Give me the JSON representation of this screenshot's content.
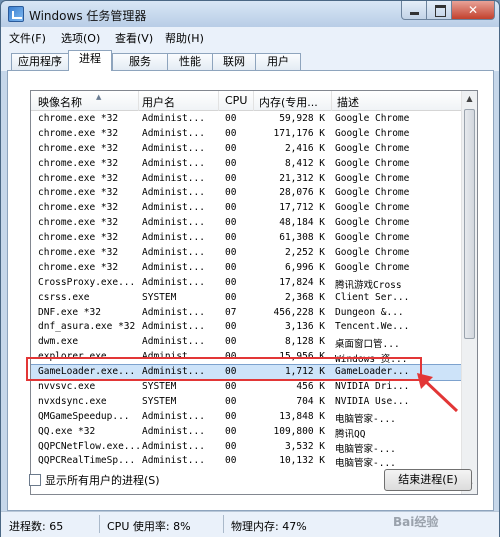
{
  "window": {
    "title": "Windows 任务管理器"
  },
  "menu": [
    {
      "label": "文件(F)"
    },
    {
      "label": "选项(O)"
    },
    {
      "label": "查看(V)"
    },
    {
      "label": "帮助(H)"
    }
  ],
  "tabs": [
    {
      "label": "应用程序"
    },
    {
      "label": "进程"
    },
    {
      "label": "服务"
    },
    {
      "label": "性能"
    },
    {
      "label": "联网"
    },
    {
      "label": "用户"
    }
  ],
  "columns": [
    {
      "label": "映像名称"
    },
    {
      "label": "用户名"
    },
    {
      "label": "CPU"
    },
    {
      "label": "内存(专用..."
    },
    {
      "label": "描述"
    }
  ],
  "processes": [
    {
      "name": "chrome.exe *32",
      "user": "Administ...",
      "cpu": "00",
      "mem": "59,928 K",
      "desc": "Google Chrome"
    },
    {
      "name": "chrome.exe *32",
      "user": "Administ...",
      "cpu": "00",
      "mem": "171,176 K",
      "desc": "Google Chrome"
    },
    {
      "name": "chrome.exe *32",
      "user": "Administ...",
      "cpu": "00",
      "mem": "2,416 K",
      "desc": "Google Chrome"
    },
    {
      "name": "chrome.exe *32",
      "user": "Administ...",
      "cpu": "00",
      "mem": "8,412 K",
      "desc": "Google Chrome"
    },
    {
      "name": "chrome.exe *32",
      "user": "Administ...",
      "cpu": "00",
      "mem": "21,312 K",
      "desc": "Google Chrome"
    },
    {
      "name": "chrome.exe *32",
      "user": "Administ...",
      "cpu": "00",
      "mem": "28,076 K",
      "desc": "Google Chrome"
    },
    {
      "name": "chrome.exe *32",
      "user": "Administ...",
      "cpu": "00",
      "mem": "17,712 K",
      "desc": "Google Chrome"
    },
    {
      "name": "chrome.exe *32",
      "user": "Administ...",
      "cpu": "00",
      "mem": "48,184 K",
      "desc": "Google Chrome"
    },
    {
      "name": "chrome.exe *32",
      "user": "Administ...",
      "cpu": "00",
      "mem": "61,308 K",
      "desc": "Google Chrome"
    },
    {
      "name": "chrome.exe *32",
      "user": "Administ...",
      "cpu": "00",
      "mem": "2,252 K",
      "desc": "Google Chrome"
    },
    {
      "name": "chrome.exe *32",
      "user": "Administ...",
      "cpu": "00",
      "mem": "6,996 K",
      "desc": "Google Chrome"
    },
    {
      "name": "CrossProxy.exe...",
      "user": "Administ...",
      "cpu": "00",
      "mem": "17,824 K",
      "desc": "腾讯游戏Cross"
    },
    {
      "name": "csrss.exe",
      "user": "SYSTEM",
      "cpu": "00",
      "mem": "2,368 K",
      "desc": "Client Ser..."
    },
    {
      "name": "DNF.exe *32",
      "user": "Administ...",
      "cpu": "07",
      "mem": "456,228 K",
      "desc": "Dungeon &..."
    },
    {
      "name": "dnf_asura.exe *32",
      "user": "Administ...",
      "cpu": "00",
      "mem": "3,136 K",
      "desc": "Tencent.We..."
    },
    {
      "name": "dwm.exe",
      "user": "Administ...",
      "cpu": "00",
      "mem": "8,128 K",
      "desc": "桌面窗口管..."
    },
    {
      "name": "explorer.exe",
      "user": "Administ...",
      "cpu": "00",
      "mem": "15,956 K",
      "desc": "Windows 资..."
    },
    {
      "name": "GameLoader.exe...",
      "user": "Administ...",
      "cpu": "00",
      "mem": "1,712 K",
      "desc": "GameLoader...",
      "selected": true
    },
    {
      "name": "nvvsvc.exe",
      "user": "SYSTEM",
      "cpu": "00",
      "mem": "456 K",
      "desc": "NVIDIA Dri..."
    },
    {
      "name": "nvxdsync.exe",
      "user": "SYSTEM",
      "cpu": "00",
      "mem": "704 K",
      "desc": "NVIDIA Use..."
    },
    {
      "name": "QMGameSpeedup...",
      "user": "Administ...",
      "cpu": "00",
      "mem": "13,848 K",
      "desc": "电脑管家-..."
    },
    {
      "name": "QQ.exe *32",
      "user": "Administ...",
      "cpu": "00",
      "mem": "109,800 K",
      "desc": "腾讯QQ"
    },
    {
      "name": "QQPCNetFlow.exe...",
      "user": "Administ...",
      "cpu": "00",
      "mem": "3,532 K",
      "desc": "电脑管家-..."
    },
    {
      "name": "QQPCRealTimeSp...",
      "user": "Administ...",
      "cpu": "00",
      "mem": "10,132 K",
      "desc": "电脑管家-..."
    }
  ],
  "show_all_label": "显示所有用户的进程(S)",
  "end_process_label": "结束进程(E)",
  "status": {
    "processes": "进程数: 65",
    "cpu": "CPU 使用率: 8%",
    "memory": "物理内存: 47%"
  },
  "watermark": "Bai经验"
}
